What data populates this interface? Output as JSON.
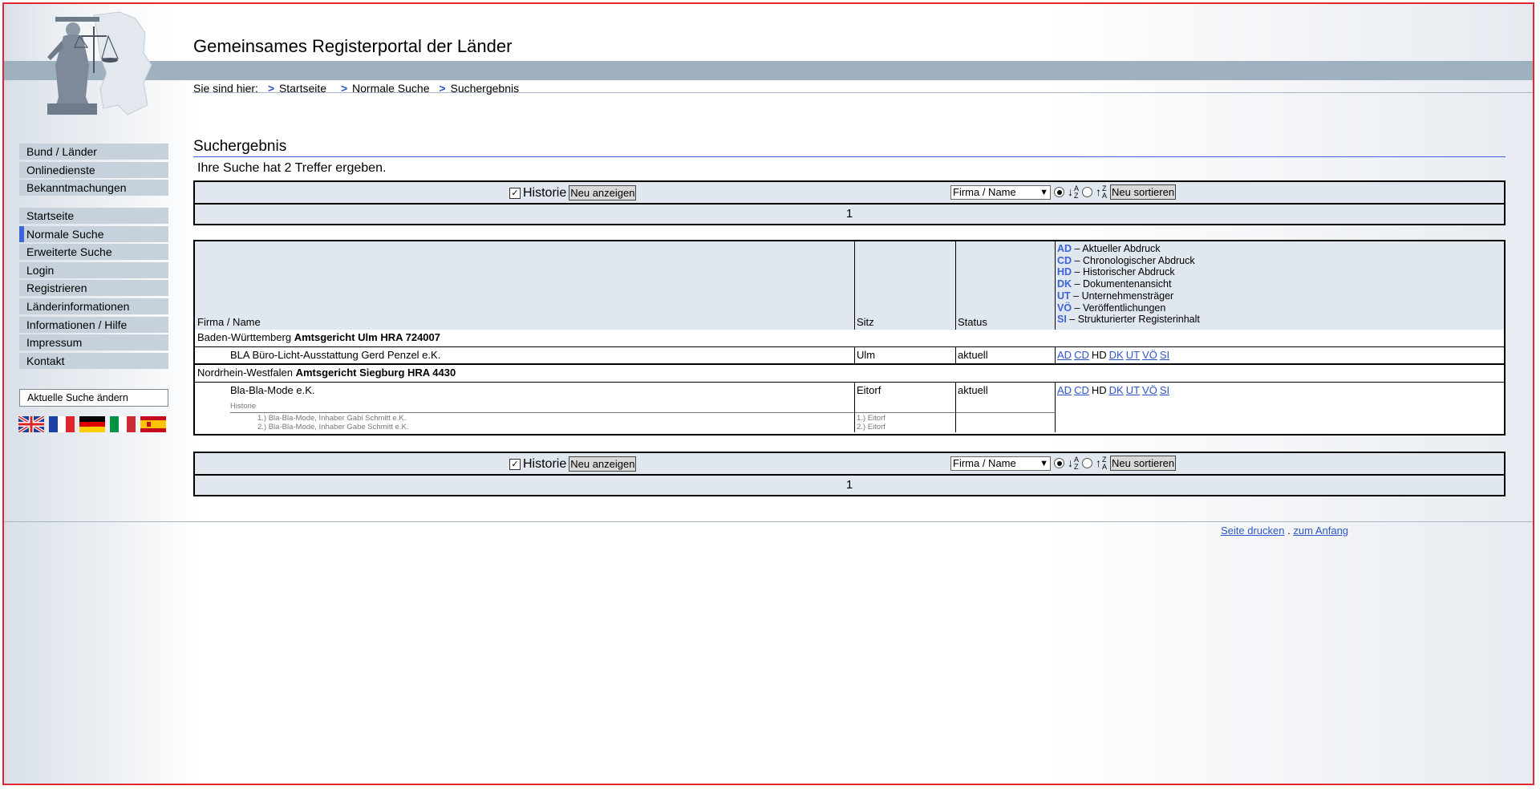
{
  "header": {
    "site_title": "Gemeinsames Registerportal der Länder",
    "breadcrumb_prefix": "Sie sind hier:",
    "breadcrumb_sep": ">",
    "breadcrumb": [
      "Startseite",
      "Normale Suche",
      "Suchergebnis"
    ]
  },
  "sidebar": {
    "group1": [
      "Bund / Länder",
      "Onlinedienste",
      "Bekanntmachungen"
    ],
    "group2": [
      "Startseite",
      "Normale Suche",
      "Erweiterte Suche",
      "Login",
      "Registrieren",
      "Länderinformationen",
      "Informationen / Hilfe",
      "Impressum",
      "Kontakt"
    ],
    "active_item": "Normale Suche",
    "search_change": "Aktuelle Suche ändern",
    "flags": [
      "flag-uk-icon",
      "flag-france-icon",
      "flag-germany-icon",
      "flag-italy-icon",
      "flag-spain-icon"
    ]
  },
  "main": {
    "title": "Suchergebnis",
    "hits_text": "Ihre Suche hat 2 Treffer ergeben.",
    "toolbar": {
      "historie_label": "Historie",
      "historie_checked": true,
      "show_button": "Neu anzeigen",
      "sort_select": "Firma / Name",
      "sort_button": "Neu sortieren",
      "page": "1"
    },
    "table": {
      "columns": [
        "Firma / Name",
        "Sitz",
        "Status"
      ],
      "legend": [
        {
          "abbr": "AD",
          "text": "– Aktueller Abdruck"
        },
        {
          "abbr": "CD",
          "text": "– Chronologischer Abdruck"
        },
        {
          "abbr": "HD",
          "text": "– Historischer Abdruck"
        },
        {
          "abbr": "DK",
          "text": "– Dokumentenansicht"
        },
        {
          "abbr": "UT",
          "text": "– Unternehmensträger"
        },
        {
          "abbr": "VÖ",
          "text": "– Veröffentlichungen"
        },
        {
          "abbr": "SI",
          "text": "– Strukturierter Registerinhalt"
        }
      ],
      "groups": [
        {
          "state": "Baden-Württemberg",
          "court": "Amtsgericht Ulm HRA 724007",
          "name": "BLA Büro-Licht-Ausstattung Gerd Penzel e.K.",
          "sitz": "Ulm",
          "status": "aktuell"
        },
        {
          "state": "Nordrhein-Westfalen",
          "court": "Amtsgericht Siegburg HRA 4430",
          "name": "Bla-Bla-Mode e.K.",
          "sitz": "Eitorf",
          "status": "aktuell",
          "history_label": "Historie",
          "history": [
            {
              "name": "1.) Bla-Bla-Mode, Inhaber Gabi Schmitt e.K.",
              "sitz": "1.) Eitorf"
            },
            {
              "name": "2.) Bla-Bla-Mode, Inhaber Gabe Schmitt e.K.",
              "sitz": "2.) Eitorf"
            }
          ]
        }
      ],
      "doc_links": [
        "AD",
        "CD",
        "HD",
        "DK",
        "UT",
        "VÖ",
        "SI"
      ]
    }
  },
  "footer": {
    "print": "Seite drucken",
    "sep": ".",
    "top": "zum Anfang"
  }
}
